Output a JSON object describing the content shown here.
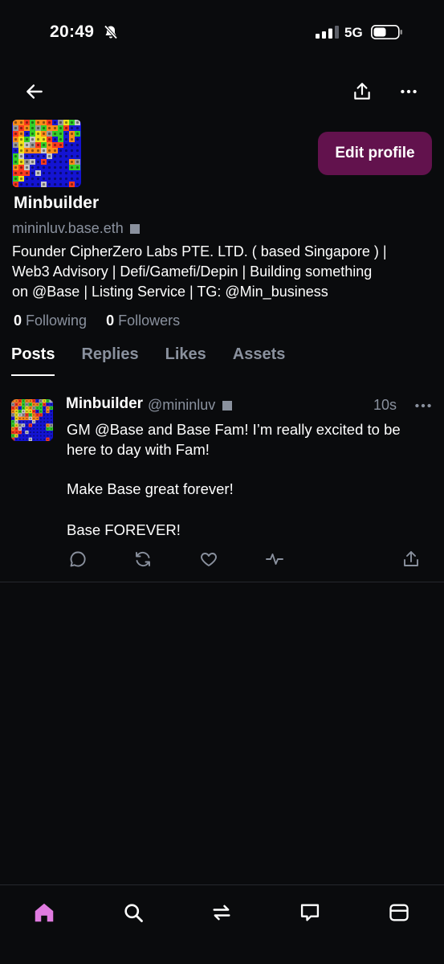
{
  "status_bar": {
    "time": "20:49",
    "network": "5G"
  },
  "profile": {
    "display_name": "Minbuilder",
    "handle": "mininluv.base.eth",
    "bio_lines": [
      "Founder CipherZero Labs PTE. LTD. ( based Singapore ) |",
      "Web3 Advisory | Defi/Gamefi/Depin | Building something",
      "on @Base | Listing Service | TG: @Min_business"
    ],
    "following_count": "0",
    "following_label": "Following",
    "followers_count": "0",
    "followers_label": "Followers",
    "edit_profile_label": "Edit profile"
  },
  "tabs": [
    {
      "label": "Posts",
      "active": true
    },
    {
      "label": "Replies",
      "active": false
    },
    {
      "label": "Likes",
      "active": false
    },
    {
      "label": "Assets",
      "active": false
    }
  ],
  "post": {
    "author": "Minbuilder",
    "handle": "@mininluv",
    "time": "10s",
    "text_lines": [
      "GM @Base and Base Fam! I’m really excited to be here to day with Fam!",
      "Make Base great forever!",
      "Base FOREVER!"
    ]
  },
  "icons": {
    "top_nav": [
      "back-arrow-icon",
      "share-icon",
      "more-icon"
    ],
    "post_actions": [
      "reply-icon",
      "recast-icon",
      "like-icon",
      "stats-icon",
      "share-icon"
    ],
    "bottom_nav": [
      "home-icon",
      "search-icon",
      "swap-icon",
      "chat-icon",
      "wallet-icon"
    ]
  },
  "colors": {
    "background": "#0a0b0d",
    "accent": "#62124d",
    "muted_text": "#8a919e",
    "active_nav": "#e07be0"
  }
}
